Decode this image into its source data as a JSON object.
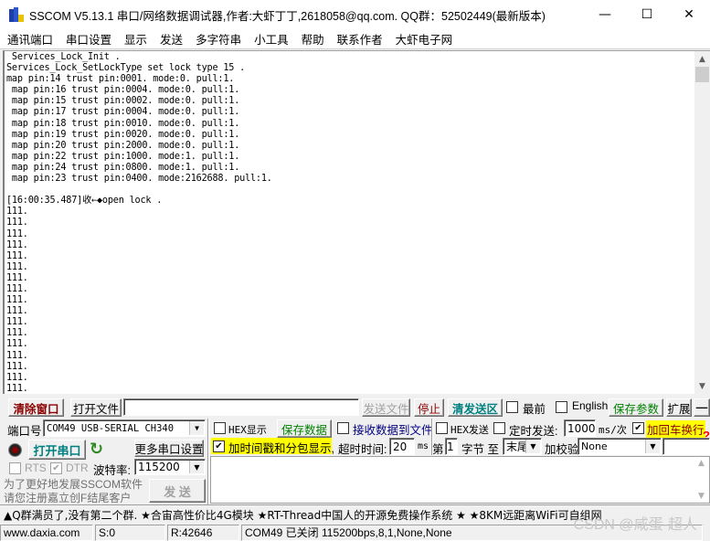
{
  "window": {
    "title": "SSCOM V5.13.1 串口/网络数据调试器,作者:大虾丁丁,2618058@qq.com. QQ群：52502449(最新版本)",
    "minimize": "—",
    "maximize": "☐",
    "close": "✕"
  },
  "menu": [
    "通讯端口",
    "串口设置",
    "显示",
    "发送",
    "多字符串",
    "小工具",
    "帮助",
    "联系作者",
    "大虾电子网"
  ],
  "receive": {
    "lines": [
      " Services_Lock_Init .",
      "Services_Lock_SetLockType set lock type 15 .",
      "map pin:14 trust pin:0001. mode:0. pull:1.",
      " map pin:16 trust pin:0004. mode:0. pull:1.",
      " map pin:15 trust pin:0002. mode:0. pull:1.",
      " map pin:17 trust pin:0004. mode:0. pull:1.",
      " map pin:18 trust pin:0010. mode:0. pull:1.",
      " map pin:19 trust pin:0020. mode:0. pull:1.",
      " map pin:20 trust pin:2000. mode:0. pull:1.",
      " map pin:22 trust pin:1000. mode:1. pull:1.",
      " map pin:24 trust pin:0800. mode:1. pull:1.",
      " map pin:23 trust pin:0400. mode:2162688. pull:1.",
      "",
      "[16:00:35.487]收←◆open lock .",
      "111.",
      "111.",
      "111.",
      "111.",
      "111.",
      "111.",
      "111.",
      "111.",
      "111.",
      "111.",
      "111.",
      "111.",
      "111.",
      "111.",
      "111.",
      "111.",
      "111."
    ]
  },
  "toolbar": {
    "clear_window": "清除窗口",
    "open_file": "打开文件",
    "file_path": "",
    "send_file": "发送文件",
    "stop": "停止",
    "clear_send": "清发送区",
    "topmost_label": "最前",
    "topmost_checked": false,
    "english_label": "English",
    "english_checked": false,
    "save_params": "保存参数",
    "expand": "扩展",
    "collapse": "—"
  },
  "port": {
    "port_label": "端口号",
    "port_value": "COM49 USB-SERIAL CH340",
    "open_port": "打开串口",
    "more_settings": "更多串口设置",
    "rts_label": "RTS",
    "rts_checked": false,
    "dtr_label": "DTR",
    "dtr_checked": true,
    "baud_label": "波特率:",
    "baud_value": "115200",
    "promo": "为了更好地发展SSCOM软件\n请您注册嘉立创F结尾客户",
    "send": "发  送"
  },
  "options": {
    "hex_display_label": "HEX显示",
    "hex_display_checked": false,
    "save_data": "保存数据",
    "recv_to_file_label": "接收数据到文件",
    "recv_to_file_checked": false,
    "hex_send_label": "HEX发送",
    "hex_send_checked": false,
    "timed_send_label": "定时发送:",
    "timed_send_checked": false,
    "timed_interval": "1000",
    "timed_unit": "ms/次",
    "add_crlf_label": "加回车换行",
    "add_crlf_checked": true,
    "timestamp_label": "加时间戳和分包显示,",
    "timestamp_checked": true,
    "timeout_label": "超时时间:",
    "timeout_value": "20",
    "timeout_unit": "ms",
    "byte_from_label": "第",
    "byte_from_value": "1",
    "byte_unit": "字节 至",
    "byte_to_value": "末尾",
    "checksum_label": "加校验",
    "checksum_value": "None",
    "help": "?"
  },
  "send_area": {
    "text": ""
  },
  "ad_text": "▲Q群满员了,没有第二个群. ★合宙高性价比4G模块 ★RT-Thread中国人的开源免费操作系统 ★ ★8KM远距离WiFi可自组网",
  "status": {
    "website": "www.daxia.com",
    "sent": "S:0",
    "received": "R:42646",
    "port_status": "COM49 已关闭  115200bps,8,1,None,None"
  },
  "watermark": "CSDN @咸蛋-超人",
  "colors": {
    "clear_window_text": "#8b0000",
    "stop_text": "#8b0000",
    "clear_send_text": "#008080",
    "save_text": "#008000",
    "open_port_text": "#008080",
    "recv_file_text": "#000080",
    "highlight": "#ffff00"
  }
}
